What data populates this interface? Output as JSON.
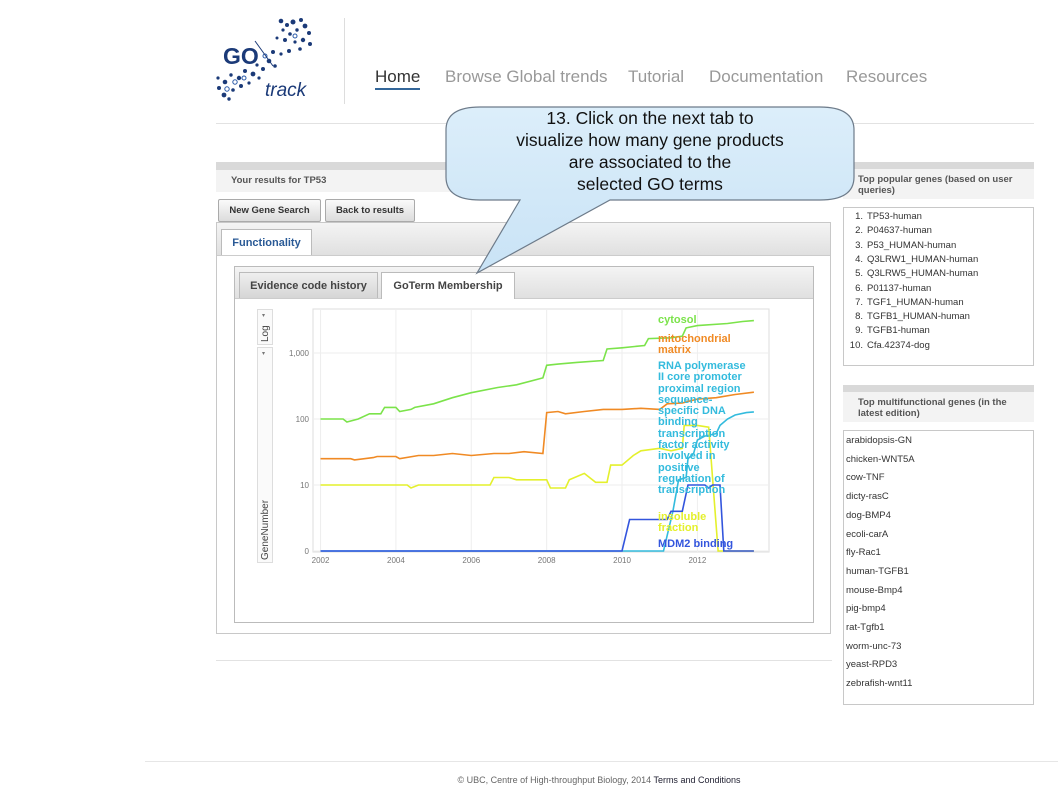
{
  "header": {
    "logo_text": "GO",
    "logo_subtext": "track",
    "nav": [
      "Home",
      "Browse Global trends",
      "Tutorial",
      "Documentation",
      "Resources"
    ]
  },
  "results": {
    "title": "Your results for TP53",
    "new_search_label": "New Gene Search",
    "back_label": "Back to results",
    "main_tab": "Functionality",
    "tabs": [
      "Evidence code history",
      "GoTerm Membership"
    ]
  },
  "callout": {
    "lines": [
      "13. Click on the next tab to",
      "visualize how many gene products",
      "are associated to the",
      "selected GO terms"
    ]
  },
  "chart_data": {
    "type": "line",
    "log_label": "Log",
    "ylabel": "GeneNumber",
    "yscale": "log",
    "y_ticks": [
      "1,000",
      "100",
      "10",
      "0"
    ],
    "x_ticks": [
      "2002",
      "2004",
      "2006",
      "2008",
      "2010",
      "2012"
    ],
    "xlim": [
      2002,
      2013.7
    ],
    "series": [
      {
        "name": "cytosol",
        "color": "#7be34a",
        "points": [
          [
            2002,
            100
          ],
          [
            2002.6,
            100
          ],
          [
            2002.7,
            90
          ],
          [
            2003,
            100
          ],
          [
            2003.3,
            120
          ],
          [
            2003.6,
            120
          ],
          [
            2003.7,
            150
          ],
          [
            2004,
            150
          ],
          [
            2004.1,
            130
          ],
          [
            2004.4,
            140
          ],
          [
            2004.5,
            150
          ],
          [
            2005,
            170
          ],
          [
            2005.5,
            210
          ],
          [
            2006,
            250
          ],
          [
            2006.7,
            300
          ],
          [
            2007.2,
            330
          ],
          [
            2007.9,
            420
          ],
          [
            2008,
            650
          ],
          [
            2008.3,
            680
          ],
          [
            2008.8,
            720
          ],
          [
            2009.5,
            770
          ],
          [
            2009.6,
            1150
          ],
          [
            2010,
            1200
          ],
          [
            2010.6,
            1300
          ],
          [
            2010.7,
            1650
          ],
          [
            2011.3,
            1700
          ],
          [
            2011.6,
            1800
          ],
          [
            2011.7,
            2400
          ],
          [
            2012,
            2600
          ],
          [
            2012.8,
            2800
          ],
          [
            2013.2,
            3000
          ],
          [
            2013.5,
            3100
          ]
        ]
      },
      {
        "name": "mitochondrial matrix",
        "color": "#f08a24",
        "points": [
          [
            2002,
            25
          ],
          [
            2002.8,
            25
          ],
          [
            2002.9,
            24
          ],
          [
            2003.4,
            26
          ],
          [
            2003.5,
            27
          ],
          [
            2004,
            27
          ],
          [
            2004.1,
            25
          ],
          [
            2004.6,
            28
          ],
          [
            2005,
            28
          ],
          [
            2005.5,
            30
          ],
          [
            2006,
            28
          ],
          [
            2006.6,
            30
          ],
          [
            2007,
            30
          ],
          [
            2007.4,
            32
          ],
          [
            2007.9,
            30
          ],
          [
            2008,
            125
          ],
          [
            2008.3,
            130
          ],
          [
            2008.5,
            120
          ],
          [
            2009,
            130
          ],
          [
            2009.5,
            140
          ],
          [
            2010,
            140
          ],
          [
            2010.5,
            145
          ],
          [
            2011,
            140
          ],
          [
            2011.2,
            170
          ],
          [
            2011.6,
            175
          ],
          [
            2012,
            200
          ],
          [
            2012.5,
            210
          ],
          [
            2013,
            235
          ],
          [
            2013.5,
            255
          ]
        ]
      },
      {
        "name": "RNA polymerase II core promoter proximal region sequence-specific DNA binding transcription factor activity involved in positive regulation of transcription",
        "color": "#33bbdd",
        "points": [
          [
            2002,
            0
          ],
          [
            2011.1,
            0
          ],
          [
            2011.35,
            4
          ],
          [
            2011.5,
            12
          ],
          [
            2011.7,
            13
          ],
          [
            2011.75,
            25
          ],
          [
            2011.9,
            30
          ],
          [
            2012,
            48
          ],
          [
            2012.2,
            55
          ],
          [
            2012.5,
            60
          ],
          [
            2012.6,
            80
          ],
          [
            2012.8,
            100
          ],
          [
            2013,
            115
          ],
          [
            2013.3,
            125
          ],
          [
            2013.5,
            128
          ]
        ]
      },
      {
        "name": "insoluble fraction",
        "color": "#e4f02c",
        "points": [
          [
            2002,
            10
          ],
          [
            2004.3,
            10
          ],
          [
            2004.4,
            9
          ],
          [
            2004.6,
            10
          ],
          [
            2006.5,
            10
          ],
          [
            2006.6,
            13
          ],
          [
            2007,
            13
          ],
          [
            2007.2,
            12
          ],
          [
            2008,
            12
          ],
          [
            2008.1,
            9
          ],
          [
            2008.5,
            9
          ],
          [
            2008.6,
            12
          ],
          [
            2009,
            15
          ],
          [
            2009.3,
            11
          ],
          [
            2009.6,
            11
          ],
          [
            2009.7,
            20
          ],
          [
            2010,
            20
          ],
          [
            2010.3,
            28
          ],
          [
            2010.5,
            33
          ],
          [
            2011,
            36
          ],
          [
            2011.3,
            33
          ],
          [
            2011.6,
            36
          ],
          [
            2011.65,
            80
          ],
          [
            2012,
            80
          ],
          [
            2012.3,
            75
          ],
          [
            2012.55,
            0
          ],
          [
            2013.5,
            0
          ]
        ]
      },
      {
        "name": "MDM2 binding",
        "color": "#3355dd",
        "points": [
          [
            2002,
            0
          ],
          [
            2010,
            0
          ],
          [
            2010.2,
            3
          ],
          [
            2011.2,
            3
          ],
          [
            2011.3,
            4
          ],
          [
            2011.6,
            4
          ],
          [
            2011.75,
            10
          ],
          [
            2012.2,
            10
          ],
          [
            2012.3,
            9
          ],
          [
            2012.4,
            10
          ],
          [
            2012.6,
            10
          ],
          [
            2012.7,
            0
          ],
          [
            2013.5,
            0
          ]
        ]
      }
    ]
  },
  "popular": {
    "title": "Top popular genes (based on user queries)",
    "items": [
      "TP53-human",
      "P04637-human",
      "P53_HUMAN-human",
      "Q3LRW1_HUMAN-human",
      "Q3LRW5_HUMAN-human",
      "P01137-human",
      "TGF1_HUMAN-human",
      "TGFB1_HUMAN-human",
      "TGFB1-human",
      "Cfa.42374-dog"
    ]
  },
  "multifunctional": {
    "title": "Top multifunctional genes (in the latest edition)",
    "items": [
      "arabidopsis-GN",
      "chicken-WNT5A",
      "cow-TNF",
      "dicty-rasC",
      "dog-BMP4",
      "ecoli-carA",
      "fly-Rac1",
      "human-TGFB1",
      "mouse-Bmp4",
      "pig-bmp4",
      "rat-Tgfb1",
      "worm-unc-73",
      "yeast-RPD3",
      "zebrafish-wnt11"
    ]
  },
  "footer": {
    "text": "© UBC, Centre of High-throughput Biology, 2014",
    "link": "Terms and Conditions"
  }
}
